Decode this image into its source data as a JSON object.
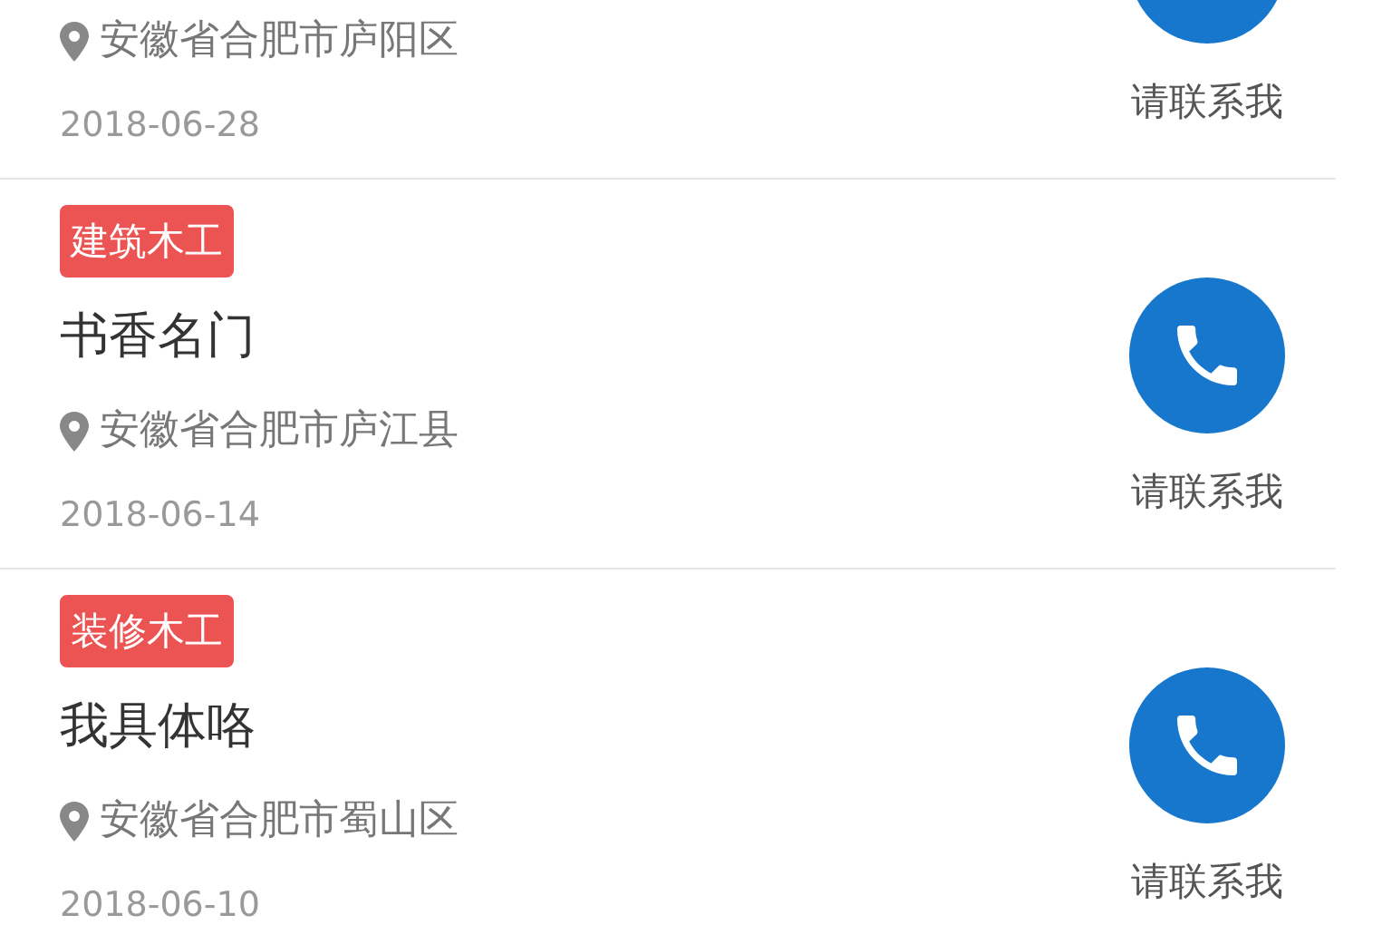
{
  "jobs": [
    {
      "location": "安徽省合肥市庐阳区",
      "date": "2018-06-28",
      "contact_label": "请联系我"
    },
    {
      "tag": "建筑木工",
      "title": "书香名门",
      "location": "安徽省合肥市庐江县",
      "date": "2018-06-14",
      "contact_label": "请联系我"
    },
    {
      "tag": "装修木工",
      "title": "我具体咯",
      "location": "安徽省合肥市蜀山区",
      "date": "2018-06-10",
      "contact_label": "请联系我"
    }
  ]
}
